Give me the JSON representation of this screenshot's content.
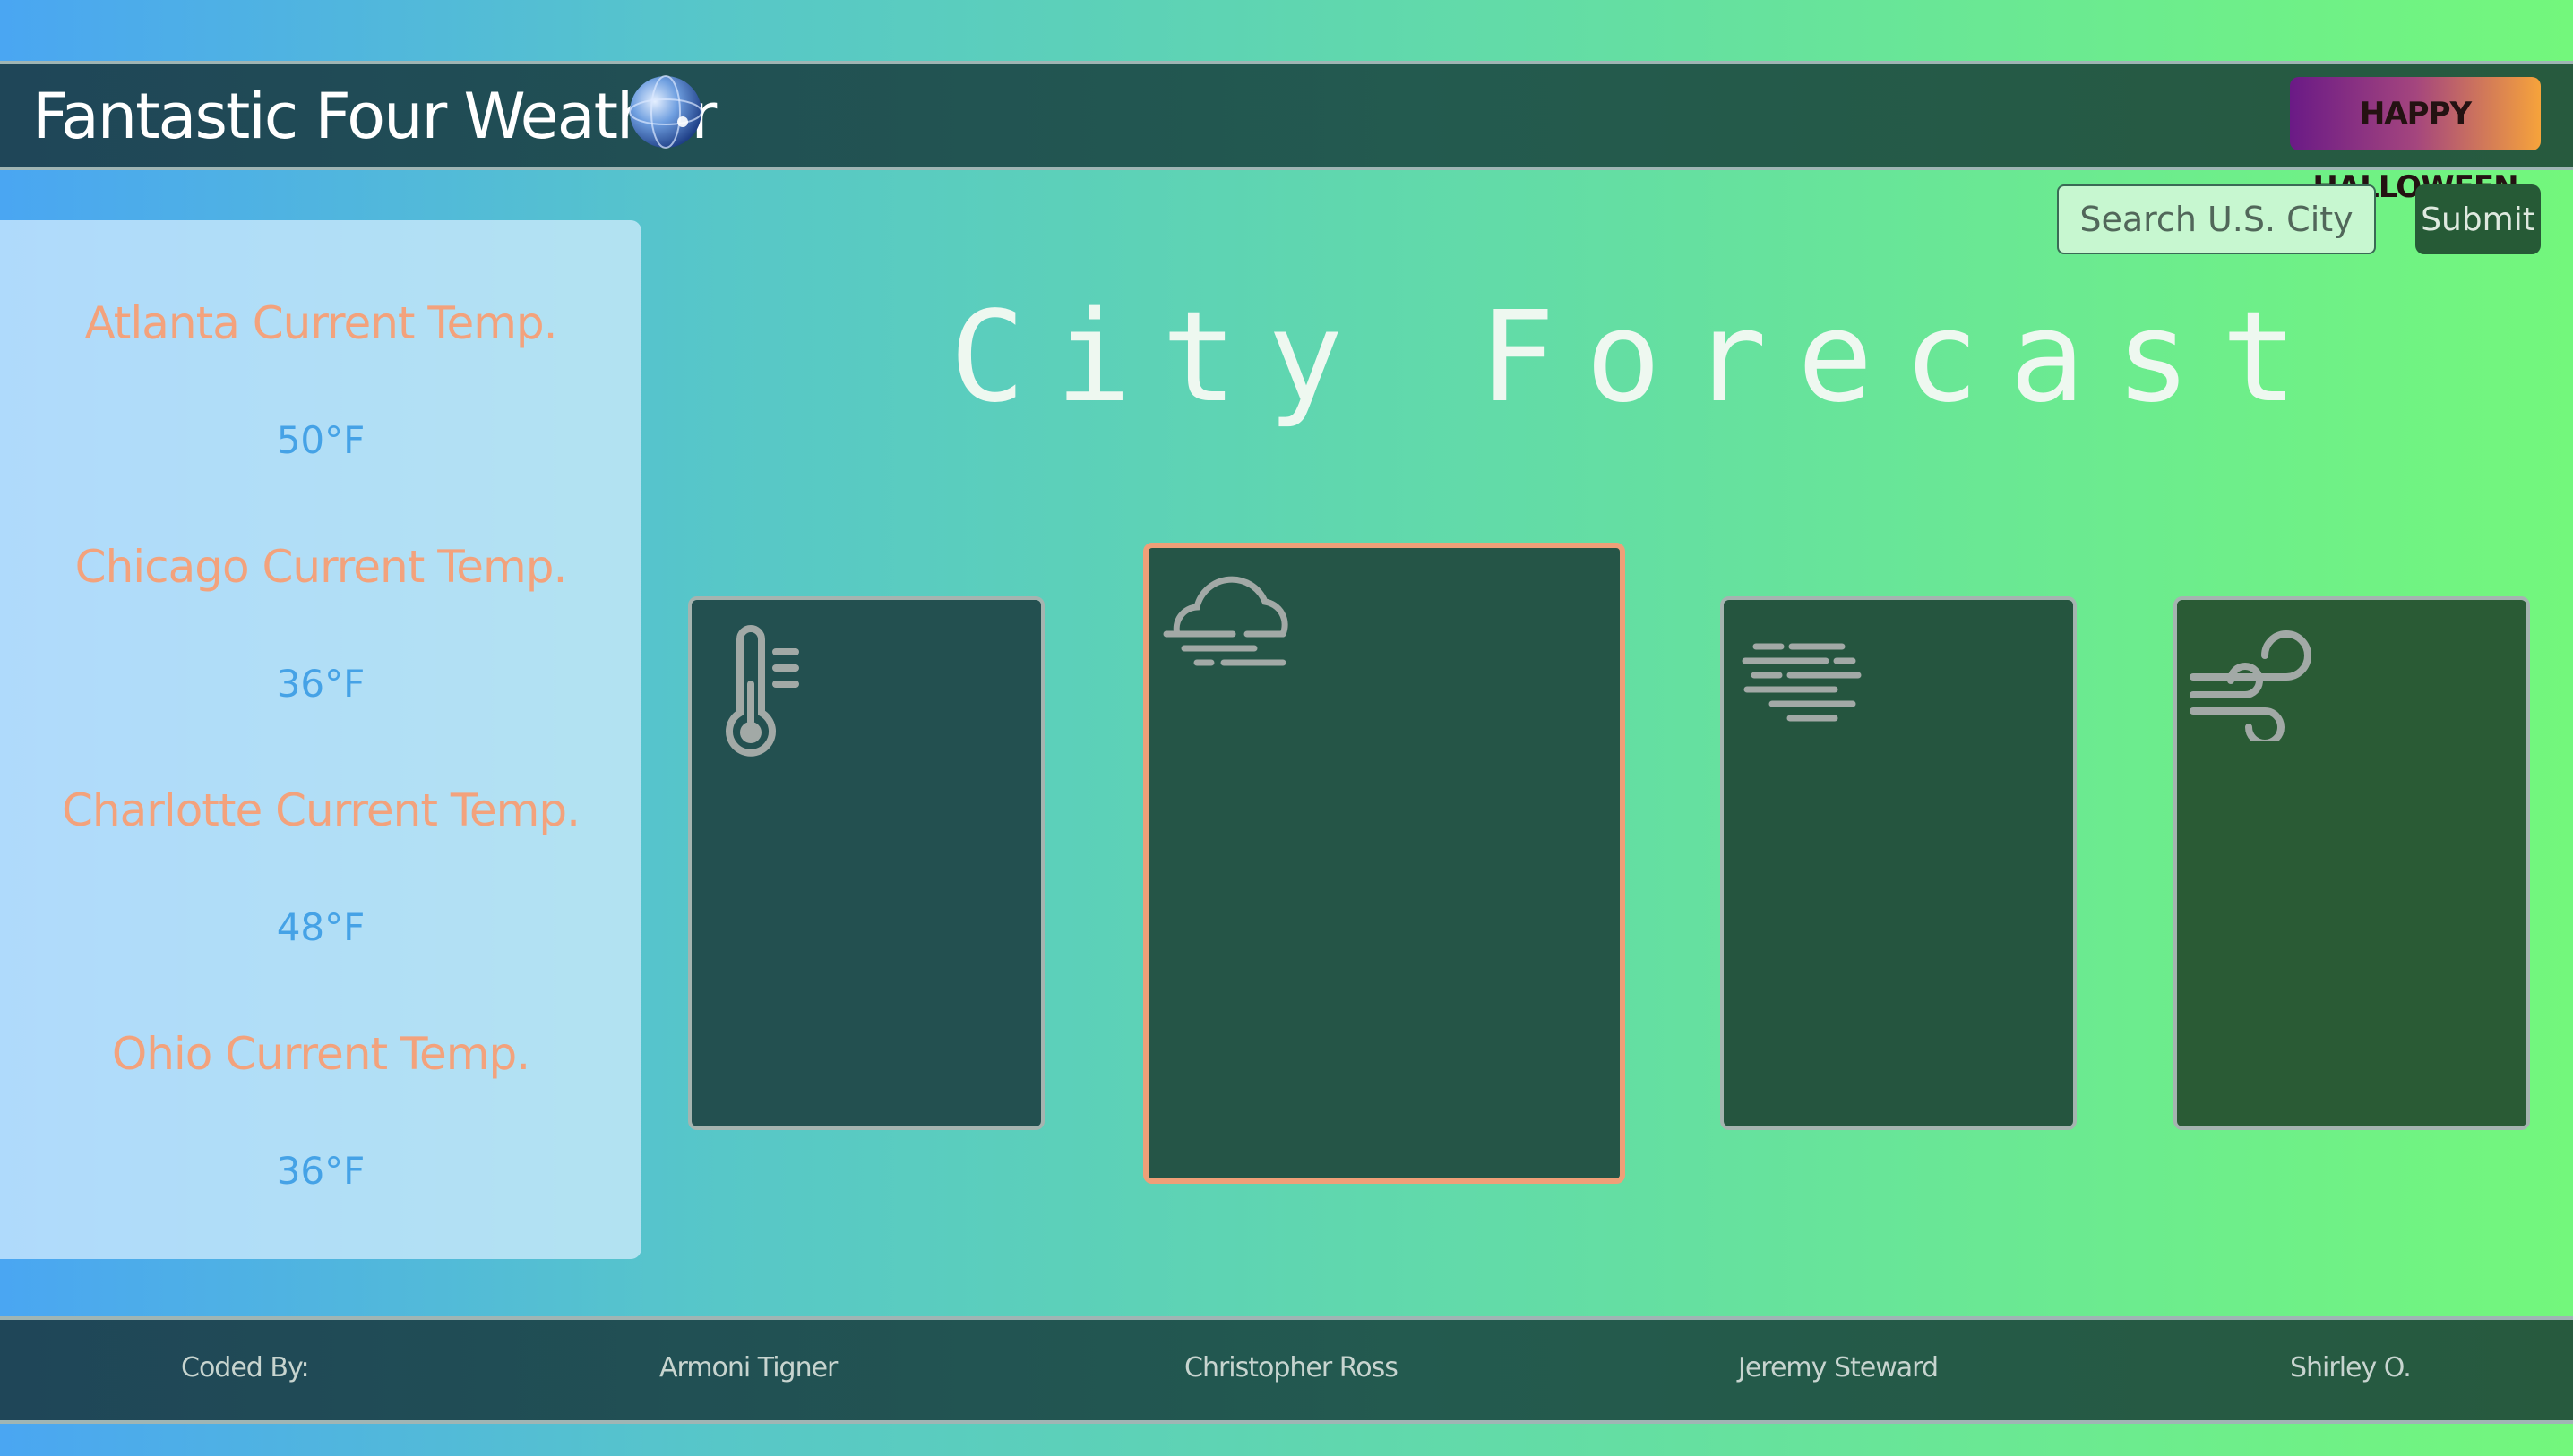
{
  "navbar": {
    "title": "Fantastic Four Weather",
    "globe_icon": "globe-icon",
    "banner_text": "HAPPY HALLOWEEN"
  },
  "search": {
    "placeholder": "Search U.S. City",
    "submit_label": "Submit"
  },
  "sidebar": {
    "cities": [
      {
        "label": "Atlanta Current Temp.",
        "temp": "50°F"
      },
      {
        "label": "Chicago Current Temp.",
        "temp": "36°F"
      },
      {
        "label": "Charlotte Current Temp.",
        "temp": "48°F"
      },
      {
        "label": "Ohio Current Temp.",
        "temp": "36°F"
      }
    ]
  },
  "main": {
    "title": "City Forecast",
    "cards": [
      {
        "icon": "thermometer-icon"
      },
      {
        "icon": "cloud-fog-icon",
        "highlighted": true
      },
      {
        "icon": "haze-icon"
      },
      {
        "icon": "wind-icon"
      }
    ]
  },
  "footer": {
    "coded_by": "Coded By:",
    "authors": [
      "Armoni Tigner",
      "Christopher Ross",
      "Jeremy Steward",
      "Shirley O."
    ]
  },
  "colors": {
    "accent_orange": "#f3a27c",
    "temp_blue": "#45a2e6",
    "card_bg": "#255550",
    "nav_bg": "#235a4f"
  }
}
